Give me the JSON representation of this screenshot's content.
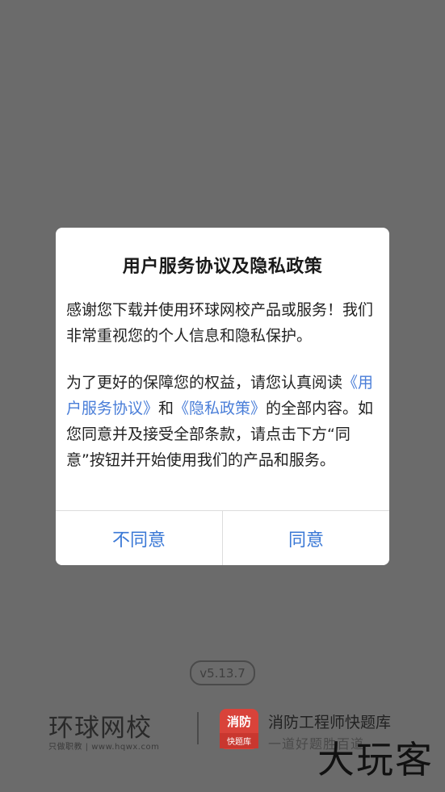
{
  "dialog": {
    "title": "用户服务协议及隐私政策",
    "para1": "感谢您下载并使用环球网校产品或服务！我们非常重视您的个人信息和隐私保护。",
    "para2_pre": "为了更好的保障您的权益，请您认真阅读",
    "link_user_agreement": "《用户服务协议》",
    "and": "和",
    "link_privacy": "《隐私政策》",
    "para2_post": "的全部内容。如您同意并及接受全部条款，请点击下方“同意”按钮并开始使用我们的产品和服务。",
    "disagree_label": "不同意",
    "agree_label": "同意"
  },
  "version": "v5.13.7",
  "footer": {
    "brand": "环球网校",
    "brand_tagline": "只做职教 | www.hqwx.com",
    "app_icon_line1": "消防",
    "app_icon_line2": "快题库",
    "app_name": "消防工程师快题库",
    "app_slogan": "一道好题胜百道"
  },
  "watermark": "大玩客",
  "colors": {
    "overlay": "#6b6b6b",
    "link": "#4a7ed8",
    "button": "#3a78d6",
    "app_icon": "#d9433a"
  }
}
